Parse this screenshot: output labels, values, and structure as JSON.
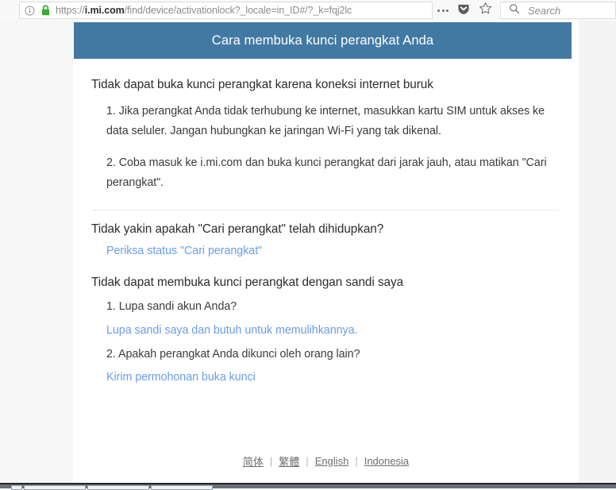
{
  "browser": {
    "url": "https://i.mi.com/find/device/activationlock?_locale=in_ID#/?_k=fqj2lc",
    "url_prefix": "https://",
    "url_domain": "i.mi.com",
    "url_suffix": "/find/device/activationlock?_locale=in_ID#/?_k=fqj2lc",
    "identity_icon": "info-circle-icon",
    "lock_icon": "green-padlock-icon",
    "lock_color": "#36ae2f",
    "toolbar_icons": [
      "more-dots-icon",
      "pocket-shield-icon",
      "bookmark-star-icon"
    ],
    "search_placeholder": "Search",
    "search_value": "",
    "search_icon": "magnifier-icon"
  },
  "page": {
    "banner_title": "Cara membuka kunci perangkat Anda",
    "banner_color": "#4279a3",
    "link_color": "#6a9ceb",
    "sections": [
      {
        "heading": "Tidak dapat buka kunci perangkat karena koneksi internet buruk",
        "paragraphs": [
          "1. Jika perangkat Anda tidak terhubung ke internet, masukkan kartu SIM untuk akses ke data seluler. Jangan hubungkan ke jaringan Wi-Fi yang tak dikenal.",
          "2. Coba masuk ke i.mi.com dan buka kunci perangkat dari jarak jauh, atau matikan \"Cari perangkat\"."
        ]
      },
      {
        "heading": "Tidak yakin apakah \"Cari perangkat\" telah dihidupkan?",
        "link": "Periksa status \"Cari perangkat\""
      },
      {
        "heading": "Tidak dapat membuka kunci perangkat dengan sandi saya",
        "question_1": "1. Lupa sandi akun Anda?",
        "link_1": "Lupa sandi saya dan butuh untuk memulihkannya.",
        "question_2": "2. Apakah perangkat Anda dikunci oleh orang lain?",
        "link_2": "Kirim permohonan buka kunci"
      }
    ]
  },
  "footer": {
    "languages": [
      {
        "label": "简体"
      },
      {
        "label": "繁體"
      },
      {
        "label": "English"
      },
      {
        "label": "Indonesia"
      }
    ],
    "separator": "|"
  }
}
